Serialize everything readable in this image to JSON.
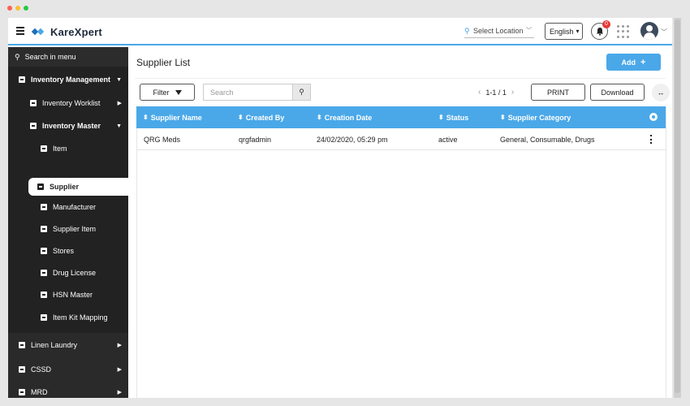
{
  "header": {
    "brand": "KareXpert",
    "location_label": "Select Location",
    "language": "English",
    "notification_count": "0"
  },
  "sidebar": {
    "search_label": "Search in menu",
    "items": [
      {
        "label": "Inventory Management"
      },
      {
        "label": "Inventory Worklist"
      },
      {
        "label": "Inventory Master"
      },
      {
        "label": "Item"
      },
      {
        "label": "Supplier"
      },
      {
        "label": "Manufacturer"
      },
      {
        "label": "Supplier Item"
      },
      {
        "label": "Stores"
      },
      {
        "label": "Drug License"
      },
      {
        "label": "HSN Master"
      },
      {
        "label": "Item Kit Mapping"
      },
      {
        "label": "Linen Laundry"
      },
      {
        "label": "CSSD"
      },
      {
        "label": "MRD"
      }
    ]
  },
  "main": {
    "title": "Supplier List",
    "add_label": "Add",
    "filter_label": "Filter",
    "search_placeholder": "Search",
    "pagination": "1-1 / 1",
    "print_label": "PRINT",
    "download_label": "Download"
  },
  "table": {
    "columns": [
      "Supplier Name",
      "Created By",
      "Creation Date",
      "Status",
      "Supplier Category"
    ],
    "rows": [
      [
        "QRG Meds",
        "qrgfadmin",
        "24/02/2020, 05:29 pm",
        "active",
        "General, Consumable, Drugs"
      ]
    ]
  },
  "colors": {
    "accent": "#4aa8e8",
    "sidebar_bg": "#222222",
    "badge": "#e53935"
  }
}
